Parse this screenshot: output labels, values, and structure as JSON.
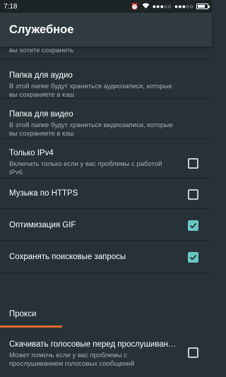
{
  "status_bar": {
    "time": "7:18",
    "icons": [
      "alarm-icon",
      "wifi-icon",
      "signal-icon",
      "battery-icon"
    ],
    "battery_level": 0.8
  },
  "toolbar": {
    "title": "Служебное"
  },
  "rows": [
    {
      "desc_partial": "вы хотите сохранить"
    },
    {
      "label": "Папка для аудио",
      "desc": "В этой папке будут храниться аудиозаписи, которые вы сохраняете в кэш"
    },
    {
      "label": "Папка для видео",
      "desc": "В этой папке будут храниться видеозаписи, которые вы сохраняете в кэш"
    },
    {
      "label": "Только IPv4",
      "desc": "Включать только если у вас проблемы с работой IPv6",
      "checked": false
    },
    {
      "label": "Музыка по HTTPS",
      "checked": false
    },
    {
      "label": "Оптимизация GIF",
      "checked": true
    },
    {
      "label": "Сохранять поисковые запросы",
      "checked": true
    },
    {
      "label": "Прокси"
    },
    {
      "label": "Скачивать голосовые перед прослушиван…",
      "desc": "Может помочь если у вас проблемы с прослушиванием голосовых сообщений",
      "checked": false
    }
  ],
  "colors": {
    "background": "#263238",
    "toolbar": "#2f3b40",
    "accent_checkbox": "#6bc7c4",
    "proxy_indicator": "#e8692c"
  }
}
